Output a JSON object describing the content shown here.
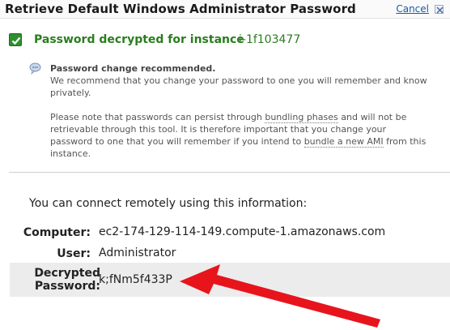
{
  "dialog": {
    "title": "Retrieve Default Windows Administrator Password",
    "cancel_label": "Cancel",
    "close_icon": "close-icon"
  },
  "status": {
    "message": "Password decrypted for instance",
    "instance_id": "i-1f103477",
    "icon": "check-icon",
    "color": "#2a7d1e"
  },
  "notice": {
    "icon": "info-bubble-icon",
    "heading": "Password change recommended.",
    "line1": "We recommend that you change your password to one you will remember and know privately.",
    "line2_before": "Please note that passwords can persist through ",
    "line2_link1": "bundling phases",
    "line2_middle": " and will not be retrievable through this tool. It is therefore important that you change your password to one that you will remember if you intend to ",
    "line2_link2": "bundle a new AMI",
    "line2_after": " from this instance."
  },
  "connection": {
    "intro": "You can connect remotely using this information:",
    "computer_label": "Computer:",
    "computer_value": "ec2-174-129-114-149.compute-1.amazonaws.com",
    "user_label": "User:",
    "user_value": "Administrator",
    "password_label_line1": "Decrypted",
    "password_label_line2": "Password:",
    "password_value": "k;fNm5f433P"
  },
  "annotation": {
    "arrow_color": "#e8141c"
  }
}
